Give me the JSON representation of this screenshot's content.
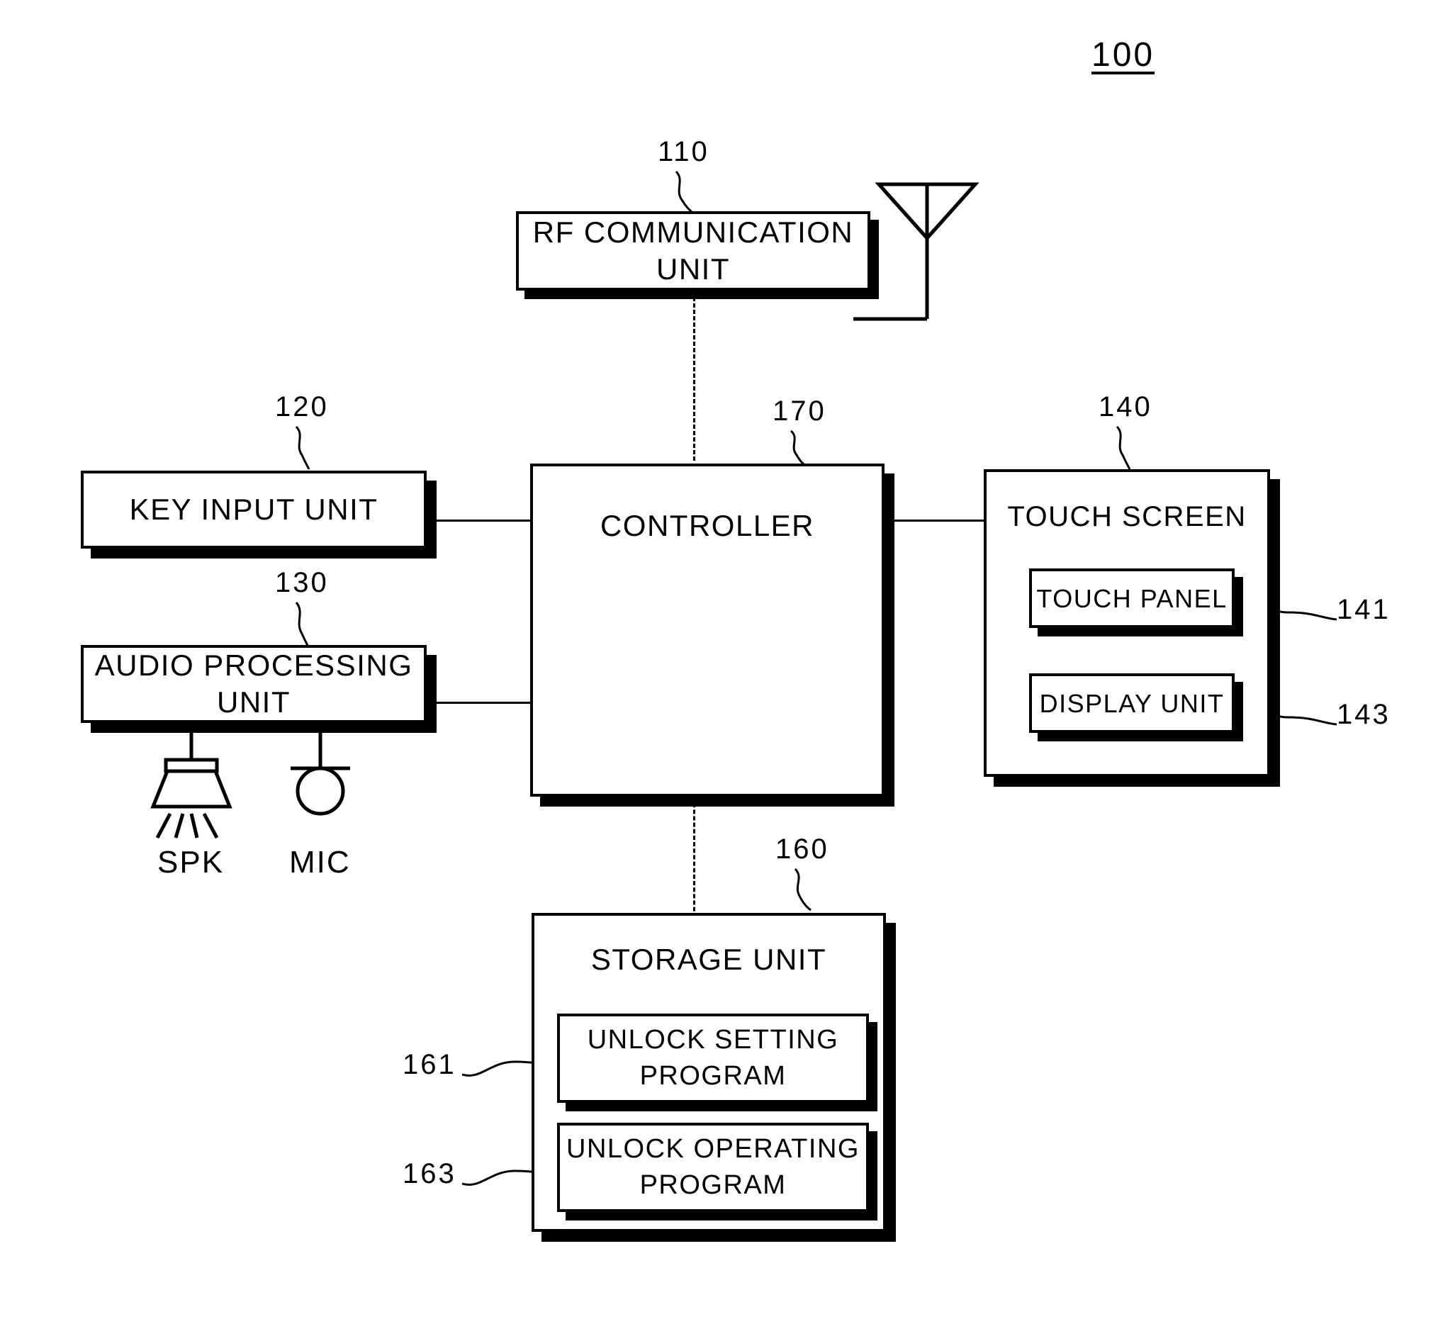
{
  "figure": {
    "device_numeral": "100",
    "blocks": [
      {
        "id": "rf",
        "label": "RF COMMUNICATION UNIT",
        "numeral": "110"
      },
      {
        "id": "key_input",
        "label": "KEY INPUT UNIT",
        "numeral": "120"
      },
      {
        "id": "audio",
        "label": "AUDIO PROCESSING UNIT",
        "numeral": "130"
      },
      {
        "id": "controller",
        "label": "CONTROLLER",
        "numeral": "170"
      },
      {
        "id": "touch_screen",
        "label": "TOUCH SCREEN",
        "numeral": "140"
      },
      {
        "id": "touch_panel",
        "label": "TOUCH PANEL",
        "numeral": "141"
      },
      {
        "id": "display_unit",
        "label": "DISPLAY UNIT",
        "numeral": "143"
      },
      {
        "id": "storage",
        "label": "STORAGE UNIT",
        "numeral": "160"
      },
      {
        "id": "unlock_setting",
        "label": "UNLOCK SETTING\nPROGRAM",
        "numeral": "161"
      },
      {
        "id": "unlock_operating",
        "label": "UNLOCK OPERATING\nPROGRAM",
        "numeral": "163"
      }
    ],
    "peripherals": [
      {
        "id": "speaker",
        "label": "SPK",
        "icon": "speaker-icon"
      },
      {
        "id": "microphone",
        "label": "MIC",
        "icon": "microphone-icon"
      }
    ],
    "antenna": {
      "icon": "antenna-icon"
    },
    "colors": {
      "ink": "#000000",
      "paper": "#ffffff"
    }
  }
}
